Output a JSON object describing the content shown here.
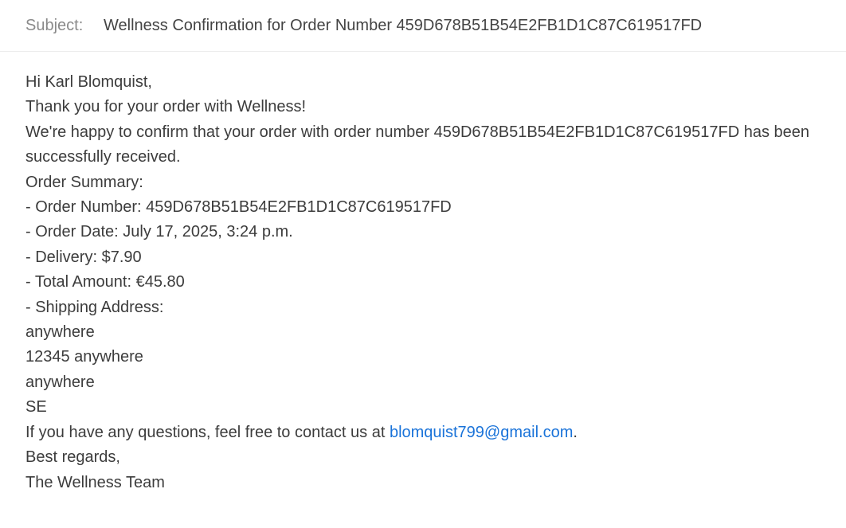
{
  "email": {
    "subject_label": "Subject:",
    "subject": "Wellness Confirmation for Order Number 459D678B51B54E2FB1D1C87C619517FD",
    "greeting": "Hi Karl Blomquist,",
    "thanks": "Thank you for your order with Wellness!",
    "confirm": "We're happy to confirm that your order with order number 459D678B51B54E2FB1D1C87C619517FD has been successfully received.",
    "summary_heading": "Order Summary:",
    "order_number": "- Order Number: 459D678B51B54E2FB1D1C87C619517FD",
    "order_date": "- Order Date: July 17, 2025, 3:24 p.m.",
    "delivery": "- Delivery: $7.90",
    "total": "- Total Amount: €45.80",
    "shipping_heading": "- Shipping Address:",
    "address_line1": "anywhere",
    "address_line2": "12345 anywhere",
    "address_line3": "anywhere",
    "address_country": "SE",
    "contact_prefix": "If you have any questions, feel free to contact us at ",
    "contact_email": "blomquist799@gmail.com",
    "contact_suffix": ".",
    "regards": "Best regards,",
    "signature": "The Wellness Team"
  },
  "colors": {
    "link": "#1a73d9",
    "label": "#8a8a8a",
    "text": "#3c3c3c"
  }
}
